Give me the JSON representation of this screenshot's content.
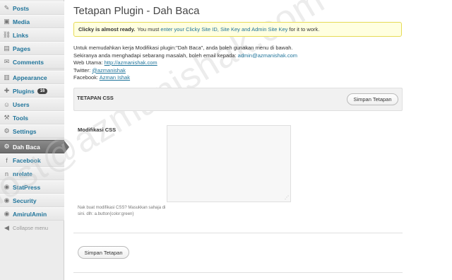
{
  "sidebar": {
    "items": [
      {
        "label": "Posts",
        "icon": "pin-icon",
        "glyph": "✎"
      },
      {
        "label": "Media",
        "icon": "media-icon",
        "glyph": "▣"
      },
      {
        "label": "Links",
        "icon": "links-icon",
        "glyph": "⛓"
      },
      {
        "label": "Pages",
        "icon": "pages-icon",
        "glyph": "▤"
      },
      {
        "label": "Comments",
        "icon": "comments-icon",
        "glyph": "✉"
      },
      {
        "label": "Appearance",
        "icon": "appearance-icon",
        "glyph": "▥"
      },
      {
        "label": "Plugins",
        "icon": "plugins-icon",
        "glyph": "✚",
        "badge": "16"
      },
      {
        "label": "Users",
        "icon": "users-icon",
        "glyph": "☺"
      },
      {
        "label": "Tools",
        "icon": "tools-icon",
        "glyph": "⚒"
      },
      {
        "label": "Settings",
        "icon": "settings-icon",
        "glyph": "⚙"
      },
      {
        "label": "Dah Baca",
        "icon": "gear-icon",
        "glyph": "⚙"
      },
      {
        "label": "Facebook",
        "icon": "facebook-icon",
        "glyph": "f"
      },
      {
        "label": "nrelate",
        "icon": "nrelate-icon",
        "glyph": "n"
      },
      {
        "label": "StatPress",
        "icon": "statpress-icon",
        "glyph": "◉"
      },
      {
        "label": "Security",
        "icon": "security-icon",
        "glyph": "◉"
      },
      {
        "label": "AmirulAmin",
        "icon": "amirulamin-icon",
        "glyph": "◉"
      },
      {
        "label": "Collapse menu",
        "icon": "collapse-icon",
        "glyph": "◀"
      }
    ]
  },
  "page": {
    "title": "Tetapan Plugin - Dah Baca"
  },
  "notice": {
    "bold": "Clicky is almost ready.",
    "pre": "You must",
    "link": "enter your Clicky Site ID, Site Key and Admin Site Key",
    "post": "for it to work."
  },
  "info": {
    "line1": "Untuk memudahkan kerja Modifikasi plugin:\"Dah Baca\", anda boleh gunakan menu di bawah.",
    "line2_pre": "Sekiranya anda menghadapi sebarang masalah, boleh email kepada:",
    "line2_email": "admin@azmanishak.com",
    "line3_pre": "Web Utama:",
    "line3_link": "http://azmanishak.com",
    "line4_pre": "Twitter:",
    "line4_link": "@azmanishak",
    "line5_pre": "Facebook:",
    "line5_link": "Azman Ishak"
  },
  "css_section": {
    "title": "TETAPAN CSS",
    "save_label": "Simpan Tetapan",
    "field_label": "Modifikasi CSS",
    "textarea_value": "",
    "hint": "Nak buat modifikasi CSS? Masukkan sahaja di sini. dlh: a.button{color:green}"
  },
  "footer": {
    "save_label": "Simpan Tetapan"
  },
  "watermark": "host@azmanishak.com"
}
